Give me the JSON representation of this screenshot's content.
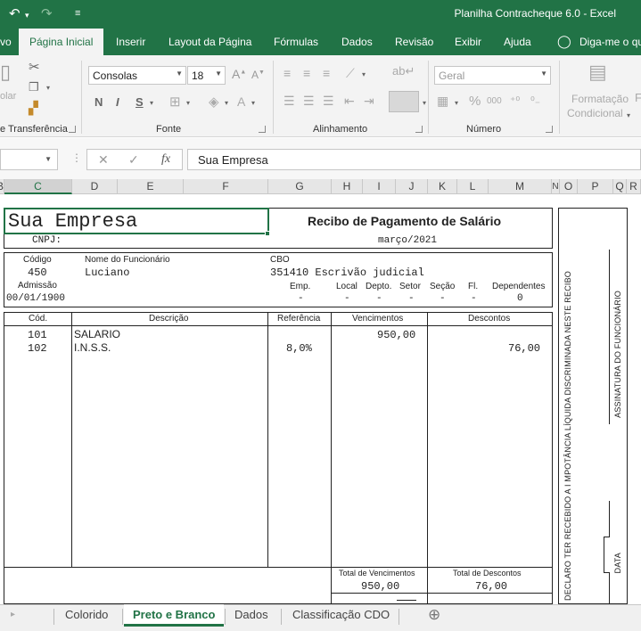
{
  "window": {
    "title": "Planilha Contracheque 6.0  -  Excel",
    "undo_glyph": "↶",
    "redo_glyph": "↷",
    "qa_more_glyph": "≡"
  },
  "ribbon_tabs": [
    "vo",
    "Página Inicial",
    "Inserir",
    "Layout da Página",
    "Fórmulas",
    "Dados",
    "Revisão",
    "Exibir",
    "Ajuda",
    "Diga-me o qu"
  ],
  "active_tab": "Página Inicial",
  "ribbon": {
    "clipboard": {
      "label": "e Transferência",
      "paste_fragment": "olar"
    },
    "font": {
      "label": "Fonte",
      "name": "Consolas",
      "size": "18",
      "bold": "N",
      "italic": "I",
      "underline": "S"
    },
    "alignment": {
      "label": "Alinhamento"
    },
    "number": {
      "label": "Número",
      "format": "Geral",
      "percent": "%",
      "thousands": "000"
    },
    "styles": {
      "conditional_line1": "Formatação",
      "conditional_line2": "Condicional",
      "next_fragment": "F"
    }
  },
  "formula_bar": {
    "fx": "fx",
    "cancel": "✕",
    "enter": "✓",
    "content": "Sua Empresa"
  },
  "columns": [
    "B",
    "C",
    "D",
    "E",
    "F",
    "G",
    "H",
    "I",
    "J",
    "K",
    "L",
    "M",
    "N",
    "O",
    "P",
    "Q",
    "R"
  ],
  "selected_column": "C",
  "receipt": {
    "company": "Sua Empresa",
    "cnpj_label": "CNPJ:",
    "title": "Recibo de Pagamento de Salário",
    "period": "março/2021",
    "code_label": "Código",
    "code": "450",
    "employee_label": "Nome do Funcionário",
    "employee": "Luciano",
    "cbo_label": "CBO",
    "cbo": "351410 Escrivão judicial",
    "admission_label": "Admissão",
    "admission": "00/01/1900",
    "emp_label": "Emp.",
    "emp": "-",
    "local_label": "Local",
    "local": "-",
    "dept_label": "Depto.",
    "dept": "-",
    "sector_label": "Setor",
    "sector": "-",
    "section_label": "Seção",
    "section": "-",
    "fl_label": "Fl.",
    "fl": "-",
    "dependents_label": "Dependentes",
    "dependents": "0",
    "table_headers": {
      "code": "Cód.",
      "description": "Descrição",
      "reference": "Referência",
      "earnings": "Vencimentos",
      "deductions": "Descontos"
    },
    "items": [
      {
        "code": "101",
        "description": "SALARIO",
        "reference": "",
        "earnings": "950,00",
        "deductions": ""
      },
      {
        "code": "102",
        "description": "I.N.S.S.",
        "reference": "8,0%",
        "earnings": "",
        "deductions": "76,00"
      }
    ],
    "total_earnings_label": "Total de Vencimentos",
    "total_earnings": "950,00",
    "total_deductions_label": "Total de Descontos",
    "total_deductions": "76,00",
    "side_declaration": "DECLARO TER RECEBIDO  A I MPOTÂNCIA LÍQUIDA DISCRIMINADA NESTE RECIBO",
    "signature_label": "ASSINATURA DO FUNCIONÁRIO",
    "date_label": "DATA"
  },
  "sheet_tabs": [
    "Colorido",
    "Preto e Branco",
    "Dados",
    "Classificação CDO"
  ],
  "active_sheet": "Preto e Branco",
  "add_sheet_glyph": "⊕",
  "colors": {
    "excel_green": "#217346",
    "ribbon_bg": "#f3f3f3"
  }
}
